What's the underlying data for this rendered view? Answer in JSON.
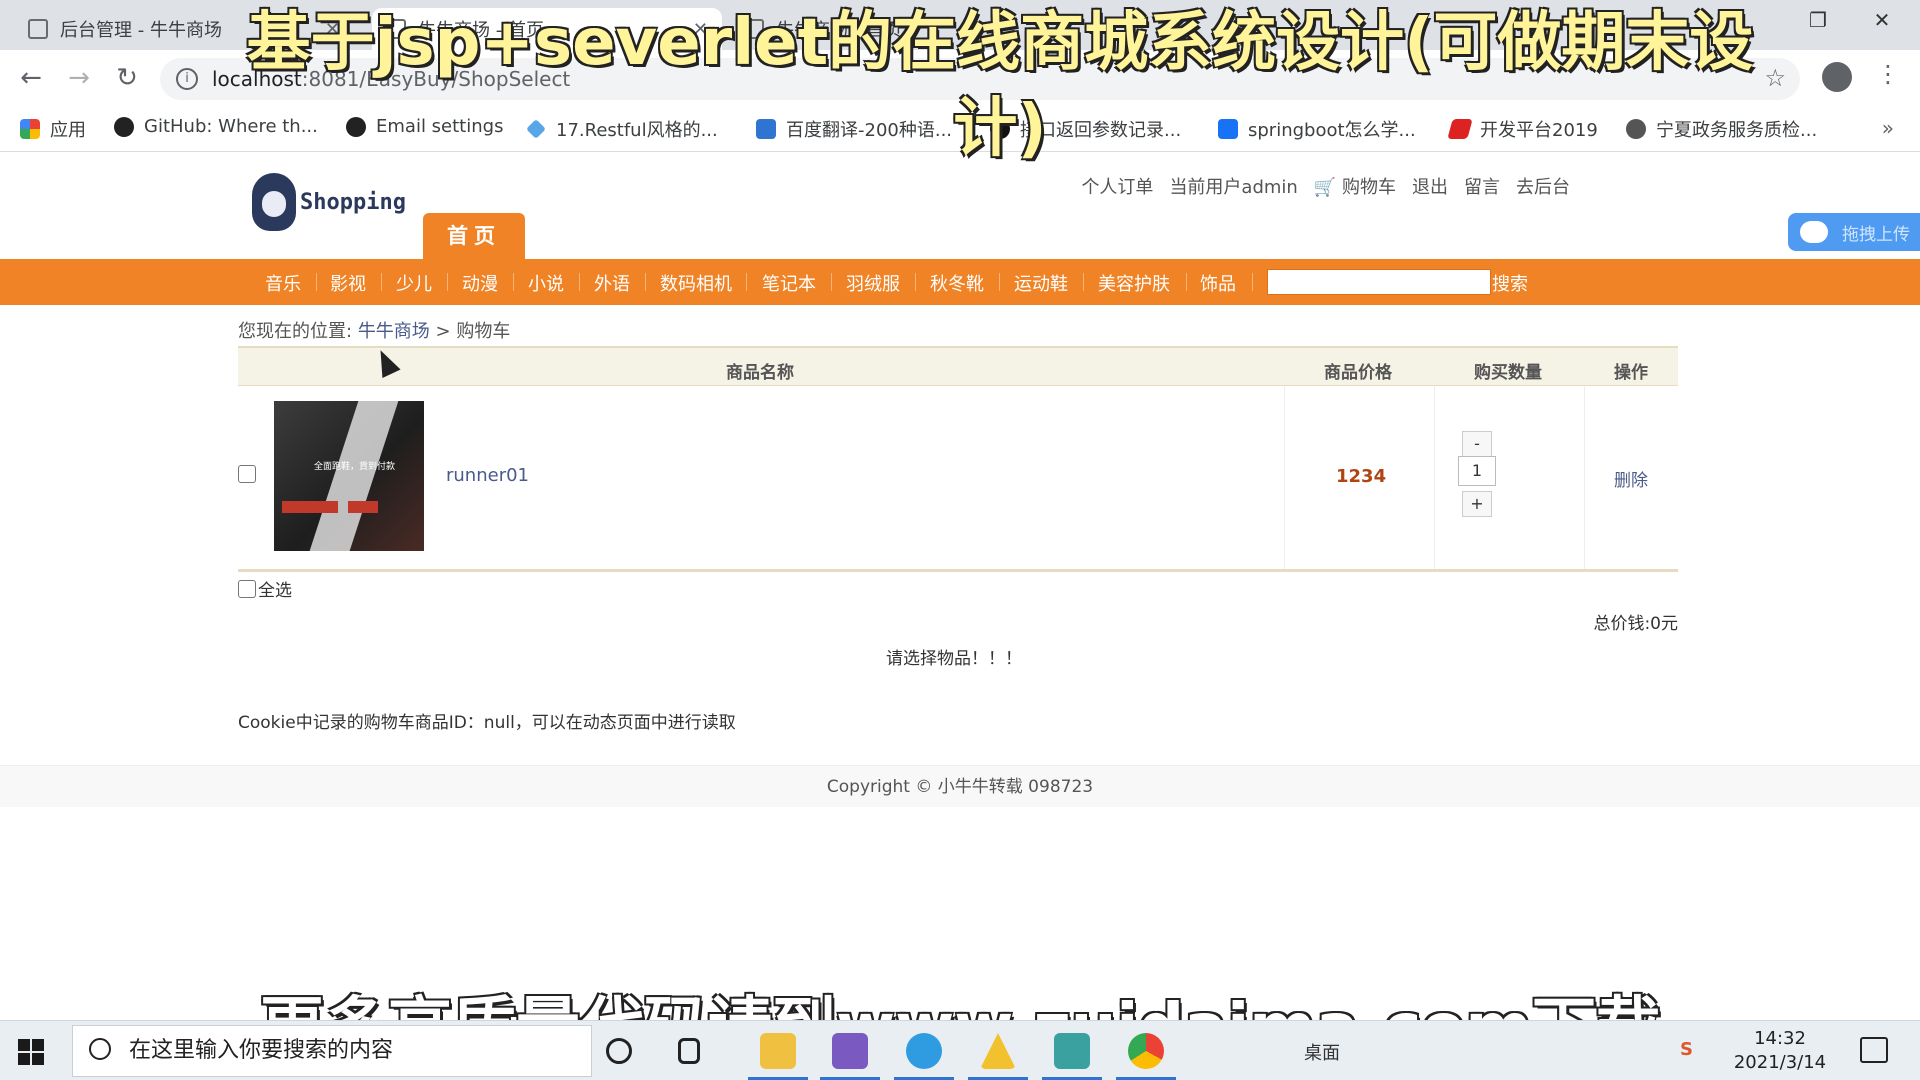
{
  "browser": {
    "tabs": [
      {
        "title": "后台管理 - 牛牛商场",
        "active": false
      },
      {
        "title": "牛牛商场 - 首页",
        "active": true
      },
      {
        "title": "牛牛商场 - 首页",
        "active": false
      }
    ],
    "url_host": "localhost",
    "url_rest": ":8081/EasyBuy/ShopSelect",
    "bookmarks": [
      {
        "label": "应用",
        "icon": "apps-grid-icon"
      },
      {
        "label": "GitHub: Where th...",
        "icon": "github-icon"
      },
      {
        "label": "Email settings",
        "icon": "github-icon"
      },
      {
        "label": "17.Restful风格的...",
        "icon": "bookmark-icon"
      },
      {
        "label": "百度翻译-200种语...",
        "icon": "translate-icon"
      },
      {
        "label": "接口返回参数记录...",
        "icon": "feather-icon"
      },
      {
        "label": "springboot怎么学...",
        "icon": "zhihu-icon"
      },
      {
        "label": "开发平台2019",
        "icon": "h-logo-icon"
      },
      {
        "label": "宁夏政务服务质检...",
        "icon": "globe-icon"
      }
    ],
    "more": "»"
  },
  "header": {
    "logo_text": "Shopping",
    "links": [
      "个人订单",
      "当前用户admin",
      "购物车",
      "退出",
      "留言",
      "去后台"
    ],
    "home_tab": "首页",
    "upload_widget": "拖拽上传"
  },
  "nav": {
    "categories": [
      "音乐",
      "影视",
      "少儿",
      "动漫",
      "小说",
      "外语",
      "数码相机",
      "笔记本",
      "羽绒服",
      "秋冬靴",
      "运动鞋",
      "美容护肤",
      "饰品"
    ],
    "search_value": "",
    "search_label": "搜索"
  },
  "breadcrumb": {
    "prefix": "您现在的位置:",
    "home": "牛牛商场",
    "separator": ">",
    "current": "购物车"
  },
  "cart": {
    "headers": {
      "name": "商品名称",
      "price": "商品价格",
      "qty": "购买数量",
      "op": "操作"
    },
    "items": [
      {
        "name": "runner01",
        "price": "1234",
        "qty": "1",
        "minus": "-",
        "plus": "+",
        "delete": "删除",
        "thumb_caption": "全面跑鞋，貨到付款"
      }
    ],
    "select_all": "全选",
    "total": "总价钱:0元",
    "prompt": "请选择物品！！！",
    "cookie_note": "Cookie中记录的购物车商品ID：null，可以在动态页面中进行读取"
  },
  "footer": {
    "copyright": "Copyright © 小牛牛转载 098723"
  },
  "overlay": {
    "top": "基于jsp+severlet的在线商城系统设计(可做期末设计)",
    "bottom": "更多高质量代码请到www.zuidaima.com下载"
  },
  "taskbar": {
    "search_placeholder": "在这里输入你要搜索的内容",
    "time": "14:32",
    "date": "2021/3/14",
    "desktop_label": "桌面"
  },
  "colors": {
    "accent_orange": "#f08326",
    "price_red": "#b04513",
    "link_blue": "#4a5a8a"
  }
}
